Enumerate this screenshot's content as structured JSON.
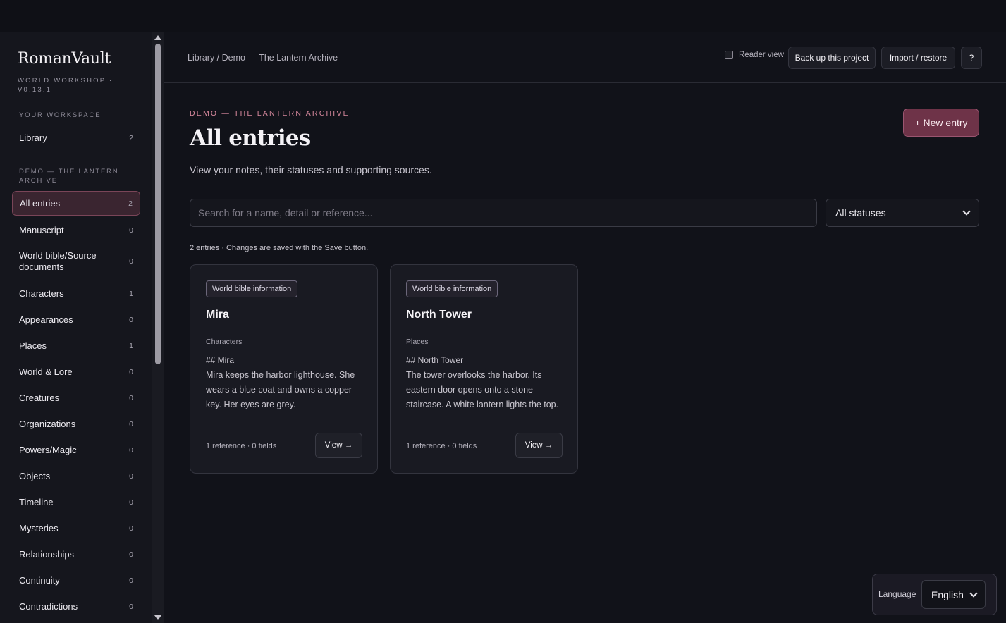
{
  "brand": {
    "name": "RomanVault",
    "subtitle": "WORLD WORKSHOP · v0.13.1"
  },
  "sidebar": {
    "workspace_label": "YOUR WORKSPACE",
    "library": {
      "label": "Library",
      "count": "2"
    },
    "project_label": "DEMO — THE LANTERN ARCHIVE",
    "items": [
      {
        "label": "All entries",
        "count": "2"
      },
      {
        "label": "Manuscript",
        "count": "0"
      },
      {
        "label": "World bible/Source documents",
        "count": "0"
      },
      {
        "label": "Characters",
        "count": "1"
      },
      {
        "label": "Appearances",
        "count": "0"
      },
      {
        "label": "Places",
        "count": "1"
      },
      {
        "label": "World & Lore",
        "count": "0"
      },
      {
        "label": "Creatures",
        "count": "0"
      },
      {
        "label": "Organizations",
        "count": "0"
      },
      {
        "label": "Powers/Magic",
        "count": "0"
      },
      {
        "label": "Objects",
        "count": "0"
      },
      {
        "label": "Timeline",
        "count": "0"
      },
      {
        "label": "Mysteries",
        "count": "0"
      },
      {
        "label": "Relationships",
        "count": "0"
      },
      {
        "label": "Continuity",
        "count": "0"
      },
      {
        "label": "Contradictions",
        "count": "0"
      }
    ]
  },
  "header": {
    "breadcrumb": "Library / Demo — The Lantern Archive",
    "reader_view": "Reader view",
    "backup": "Back up this project",
    "import": "Import / restore",
    "help": "?"
  },
  "main": {
    "eyebrow": "DEMO — THE LANTERN ARCHIVE",
    "title": "All entries",
    "description": "View your notes, their statuses and supporting sources.",
    "new_entry": "+ New entry",
    "search_placeholder": "Search for a name, detail or reference...",
    "status_filter": "All statuses",
    "meta": "2 entries · Changes are saved with the Save button."
  },
  "cards": [
    {
      "badge": "World bible information",
      "title": "Mira",
      "category": "Characters",
      "heading": "## Mira",
      "body": "Mira keeps the harbor lighthouse. She wears a blue coat and owns a copper key. Her eyes are grey.",
      "footer": "1 reference · 0 fields",
      "view": "View →"
    },
    {
      "badge": "World bible information",
      "title": "North Tower",
      "category": "Places",
      "heading": "## North Tower",
      "body": "The tower overlooks the harbor. Its eastern door opens onto a stone staircase. A white lantern lights the top.",
      "footer": "1 reference · 0 fields",
      "view": "View →"
    }
  ],
  "language": {
    "label": "Language",
    "selected": "English"
  },
  "colors": {
    "accent": "#6e3348",
    "eyebrow": "#d7889d",
    "background": "#111219",
    "active_nav": "#3a2530"
  }
}
